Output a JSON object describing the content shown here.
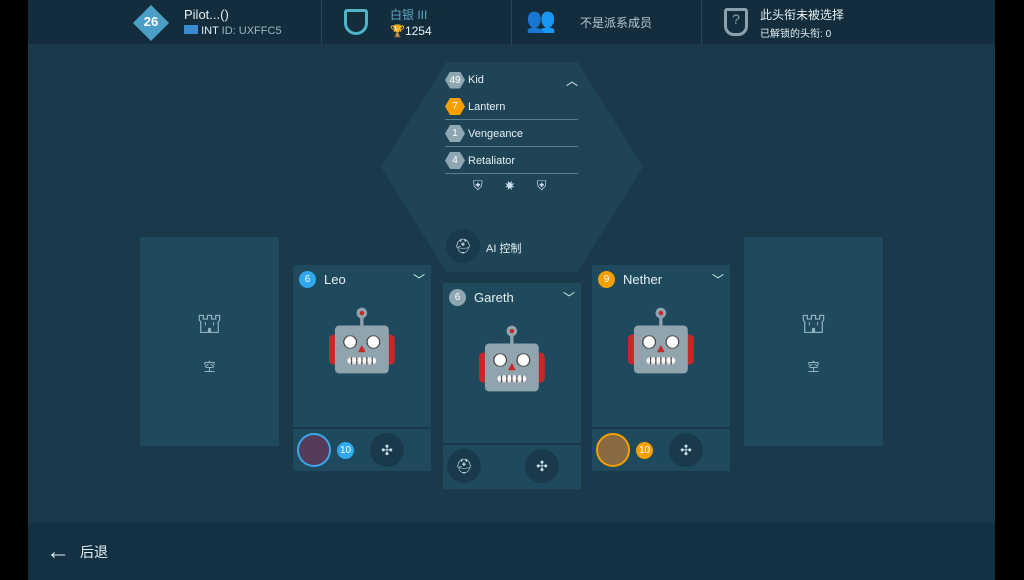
{
  "player": {
    "level": "26",
    "name": "Pilot...()",
    "region": "INT",
    "id_label": "ID:",
    "id": "UXFFC5"
  },
  "league": {
    "name": "白银 III",
    "trophies": "1254"
  },
  "clan": {
    "status": "不是派系成员"
  },
  "title": {
    "status": "此头衔未被选择",
    "unlocked_label": "已解锁的头衔:",
    "unlocked_count": "0"
  },
  "squad": {
    "leader": {
      "level": "49",
      "name": "Kid"
    },
    "members": [
      {
        "level": "7",
        "name": "Lantern",
        "color": "#f5a000"
      },
      {
        "level": "1",
        "name": "Vengeance",
        "color": "#8fa7b2"
      },
      {
        "level": "4",
        "name": "Retaliator",
        "color": "#8fa7b2"
      }
    ],
    "control": "AI 控制"
  },
  "slots": {
    "empty_label": "空"
  },
  "robots": [
    {
      "level": "6",
      "name": "Leo",
      "badge_color": "#2fa8f0",
      "pilot_level": "10"
    },
    {
      "level": "6",
      "name": "Gareth",
      "badge_color": "#8fa7b2"
    },
    {
      "level": "9",
      "name": "Nether",
      "badge_color": "#f5a000",
      "pilot_level": "10"
    }
  ],
  "back": {
    "label": "后退"
  }
}
